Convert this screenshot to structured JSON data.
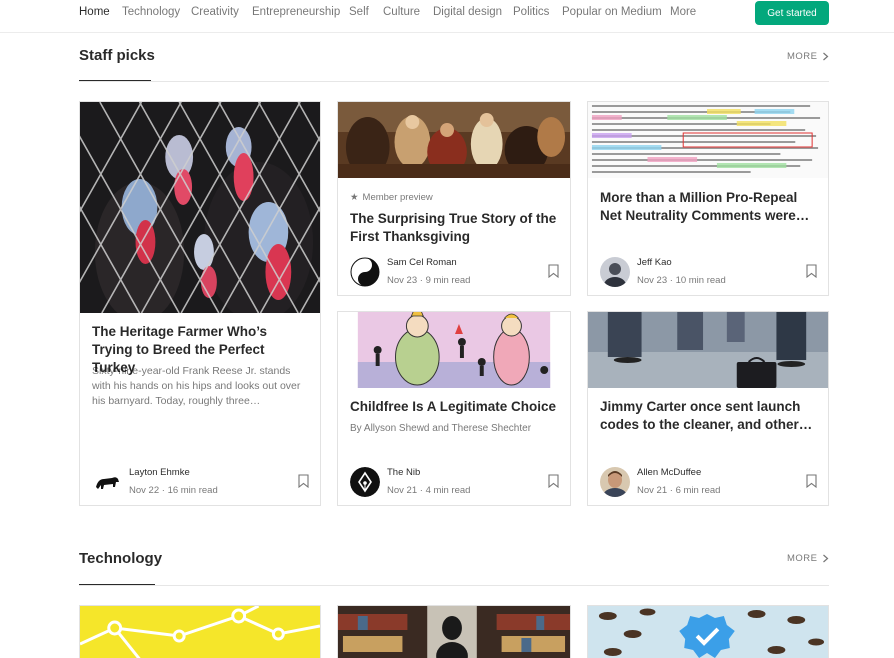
{
  "nav": {
    "items": [
      "Home",
      "Technology",
      "Creativity",
      "Entrepreneurship",
      "Self",
      "Culture",
      "Digital design",
      "Politics",
      "Popular on Medium",
      "More"
    ],
    "cta": "Get started"
  },
  "colors": {
    "accent": "#03a87c",
    "text": "#000000",
    "border": "#e2e2e2"
  },
  "sections": [
    {
      "title": "Staff picks",
      "more": "MORE"
    },
    {
      "title": "Technology",
      "more": "MORE"
    }
  ],
  "staff_picks": [
    {
      "title": "The Heritage Farmer Who’s Trying to Breed the Perfect Turkey",
      "snippet": "Sixty-nine-year-old Frank Reese Jr. stands with his hands on his hips and looks out over his barnyard. Today, roughly three…",
      "author": "Layton Ehmke",
      "date": "Nov 22",
      "read_time": "16 min read",
      "image": "turkeys-behind-fence",
      "avatar": "horse-silhouette-avatar"
    },
    {
      "label": "Member preview",
      "title": "The Surprising True Story of the First Thanksgiving",
      "author": "Sam Cel Roman",
      "date": "Nov 23",
      "read_time": "9 min read",
      "image": "thanksgiving-painting",
      "avatar": "yin-yang-avatar"
    },
    {
      "title": "More than a Million Pro-Repeal Net Neutrality Comments were…",
      "author": "Jeff Kao",
      "date": "Nov 23",
      "read_time": "10 min read",
      "image": "highlighted-comments-text",
      "avatar": "person-avatar"
    },
    {
      "title": "Childfree Is A Legitimate Choice",
      "byline": "By Allyson Shewd and Therese Shechter",
      "author": "The Nib",
      "date": "Nov 21",
      "read_time": "4 min read",
      "image": "cartoon-party-illustration",
      "avatar": "the-nib-logo-avatar"
    },
    {
      "title": "Jimmy Carter once sent launch codes to the cleaner, and other…",
      "author": "Allen McDuffee",
      "date": "Nov 21",
      "read_time": "6 min read",
      "image": "briefcase-on-ground",
      "avatar": "man-portrait-avatar"
    }
  ],
  "technology_images": [
    "yellow-network-graphic",
    "library-bookshelves",
    "verified-badge-with-insects"
  ]
}
